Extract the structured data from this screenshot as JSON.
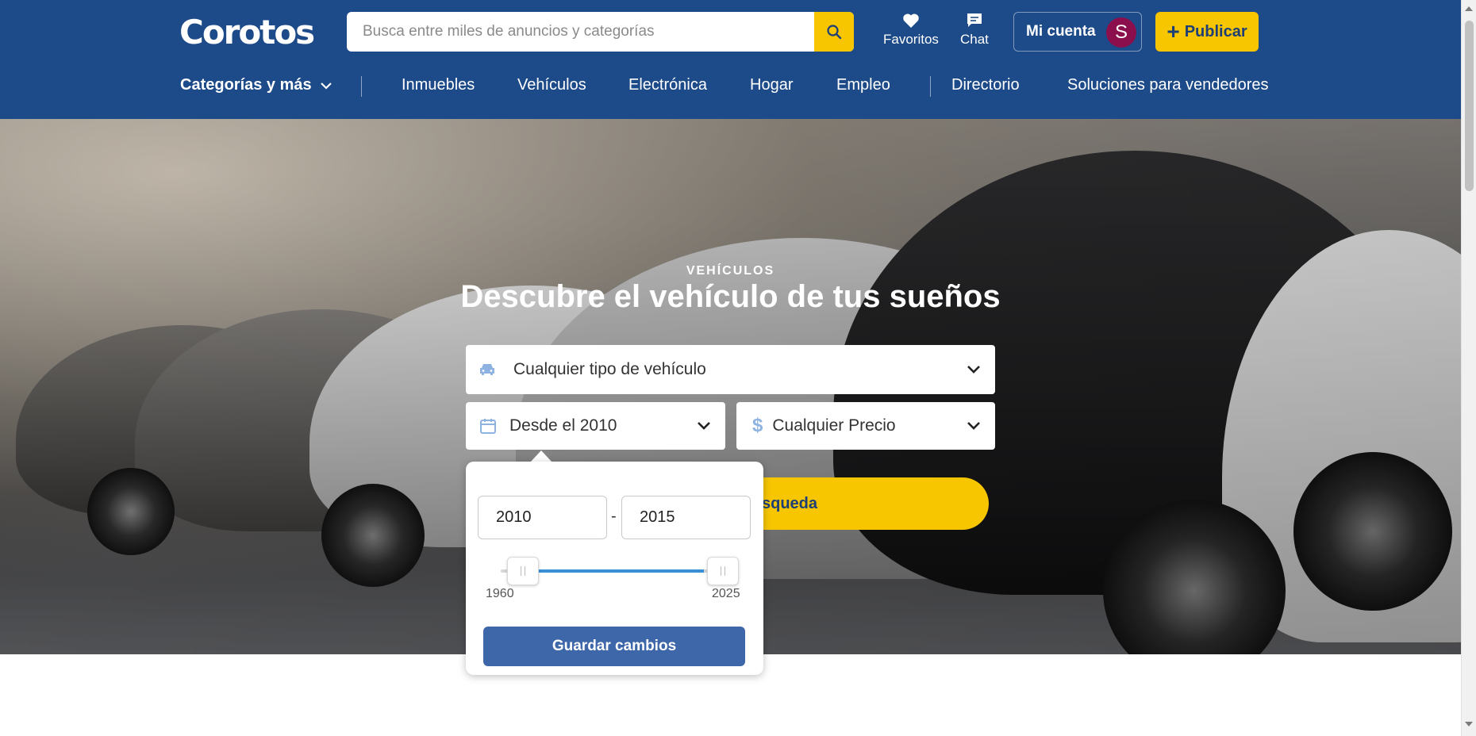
{
  "header": {
    "logo": "Corotos",
    "search_placeholder": "Busca entre miles de anuncios y categorías",
    "favorites_label": "Favoritos",
    "chat_label": "Chat",
    "account_label": "Mi cuenta",
    "avatar_initial": "S",
    "publish_label": "Publicar"
  },
  "nav": {
    "categories_label": "Categorías y más",
    "items": [
      "Inmuebles",
      "Vehículos",
      "Electrónica",
      "Hogar",
      "Empleo",
      "Directorio",
      "Soluciones para vendedores"
    ]
  },
  "hero": {
    "kicker": "VEHÍCULOS",
    "title": "Descubre el vehículo de tus sueños",
    "vehicle_type": "Cualquier tipo de vehículo",
    "year_filter": "Desde el 2010",
    "price_filter": "Cualquier Precio",
    "search_button": "squeda"
  },
  "year_popover": {
    "from_value": "2010",
    "to_value": "2015",
    "separator": "-",
    "range_min_label": "1960",
    "range_max_label": "2025",
    "save_label": "Guardar cambios"
  },
  "colors": {
    "brand_blue": "#1d4a88",
    "accent_yellow": "#f7c600",
    "save_button": "#3d67a8",
    "slider_fill": "#3a8fd4",
    "avatar": "#8b0f4c"
  }
}
